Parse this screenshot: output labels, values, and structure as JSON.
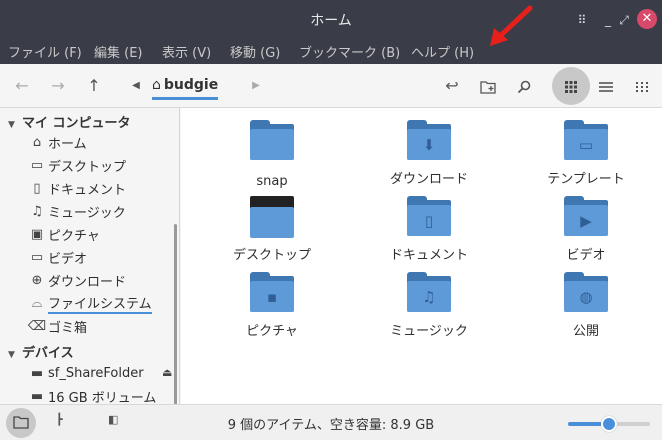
{
  "window": {
    "title": "ホーム",
    "minimize_icon": "⠿",
    "restore_icon": "_",
    "maximize_icon": "⤢",
    "close_icon": "✕"
  },
  "menubar": {
    "items": [
      "ファイル (F)",
      "編集 (E)",
      "表示 (V)",
      "移動 (G)",
      "ブックマーク (B)",
      "ヘルプ (H)"
    ]
  },
  "toolbar": {
    "back_icon": "back-arrow-icon",
    "forward_icon": "forward-arrow-icon",
    "up_icon": "up-arrow-icon",
    "breadcrumb": "budgie",
    "view_mode": "grid"
  },
  "sidebar": {
    "computer_header": "マイ コンピュータ",
    "computer_items": [
      {
        "label": "ホーム",
        "icon": "home-icon"
      },
      {
        "label": "デスクトップ",
        "icon": "desktop-icon"
      },
      {
        "label": "ドキュメント",
        "icon": "document-icon"
      },
      {
        "label": "ミュージック",
        "icon": "music-icon"
      },
      {
        "label": "ピクチャ",
        "icon": "picture-icon"
      },
      {
        "label": "ビデオ",
        "icon": "video-icon"
      },
      {
        "label": "ダウンロード",
        "icon": "download-icon"
      },
      {
        "label": "ファイルシステム",
        "icon": "drive-icon"
      },
      {
        "label": "ゴミ箱",
        "icon": "trash-icon"
      }
    ],
    "devices_header": "デバイス",
    "device_items": [
      {
        "label": "sf_ShareFolder",
        "icon": "drive-icon"
      },
      {
        "label": "16 GB ボリューム",
        "icon": "drive-icon"
      }
    ]
  },
  "main": {
    "items": [
      {
        "label": "snap",
        "glyph": ""
      },
      {
        "label": "ダウンロード",
        "glyph": "⬇"
      },
      {
        "label": "テンプレート",
        "glyph": "▭"
      },
      {
        "label": "デスクトップ",
        "glyph": ""
      },
      {
        "label": "ドキュメント",
        "glyph": "▯"
      },
      {
        "label": "ビデオ",
        "glyph": "▶"
      },
      {
        "label": "ピクチャ",
        "glyph": "▪"
      },
      {
        "label": "ミュージック",
        "glyph": "♫"
      },
      {
        "label": "公開",
        "glyph": "◍"
      }
    ]
  },
  "statusbar": {
    "text": "9 個のアイテム、空き容量: 8.9 GB",
    "zoom_level": 0.5
  },
  "colors": {
    "accent": "#4a90d9",
    "titlebar": "#3a3d48",
    "close": "#d9496b",
    "annotation_arrow": "#e8201b"
  }
}
